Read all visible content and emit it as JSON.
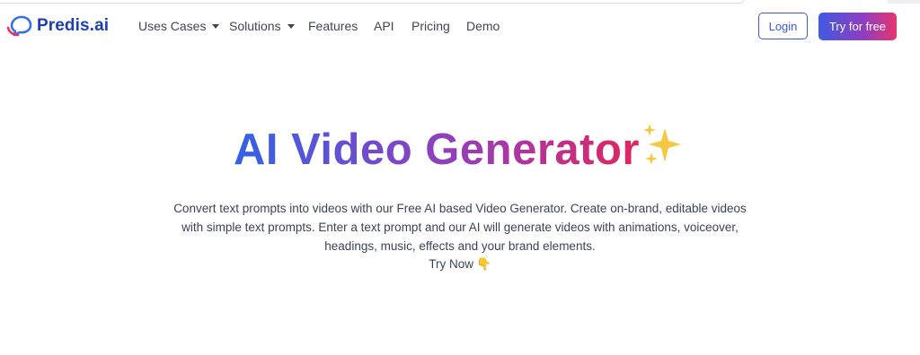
{
  "brand": {
    "name": "Predis.ai",
    "logo_icon": "speech-bubble-logo-icon",
    "color": "#1e40af"
  },
  "nav": {
    "items": [
      {
        "label": "Uses Cases",
        "dropdown": true
      },
      {
        "label": "Solutions",
        "dropdown": true
      },
      {
        "label": "Features",
        "dropdown": false
      },
      {
        "label": "API",
        "dropdown": false
      },
      {
        "label": "Pricing",
        "dropdown": false
      },
      {
        "label": "Demo",
        "dropdown": false
      }
    ],
    "login_label": "Login",
    "try_label": "Try for free"
  },
  "hero": {
    "title": "AI Video Generator",
    "title_emoji": "sparkles-icon",
    "description": "Convert text prompts into videos with our Free AI based Video Generator. Create on-brand, editable videos with simple text prompts. Enter a text prompt and our AI will generate videos with animations, voiceover, headings, music, effects and your brand elements.",
    "cta_label": "Try Now",
    "cta_emoji": "👇"
  },
  "colors": {
    "accent": "#3b5bdb",
    "gradient_start": "#3163e6",
    "gradient_mid": "#a13ab0",
    "gradient_end": "#e3245e"
  }
}
